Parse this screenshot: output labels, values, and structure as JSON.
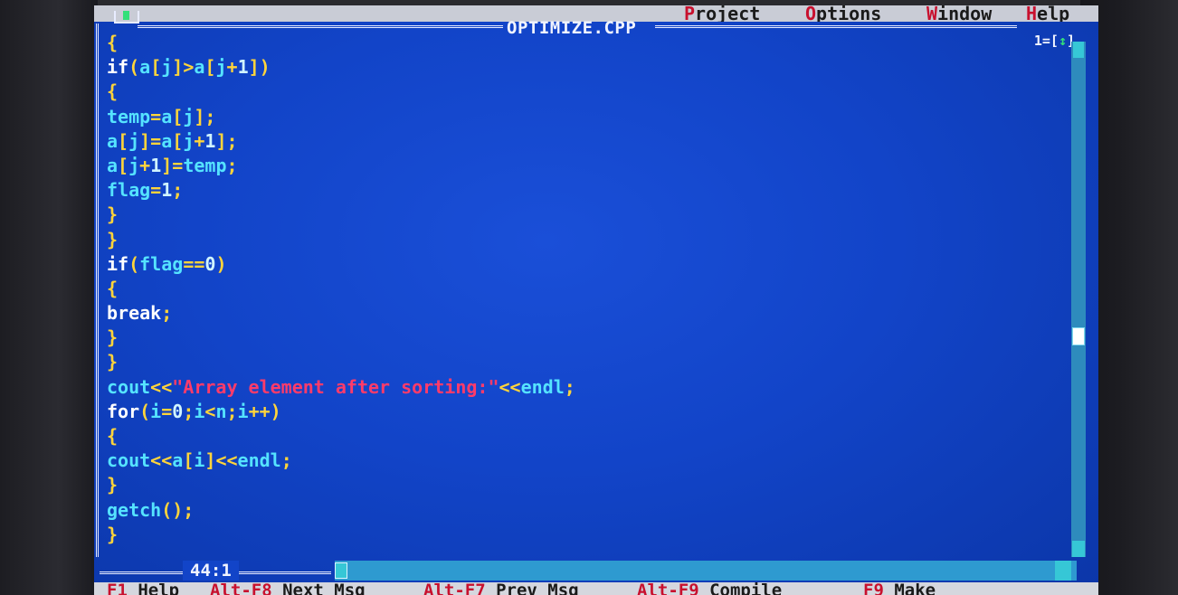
{
  "menubar": {
    "items": [
      {
        "label": "Project",
        "hot": "P"
      },
      {
        "label": "Options",
        "hot": "O"
      },
      {
        "label": "Window",
        "hot": "W"
      },
      {
        "label": "Help",
        "hot": "H"
      }
    ]
  },
  "window": {
    "title": "OPTIMIZE.CPP",
    "number": "1=[",
    "zoom_glyph": "↕",
    "zoom_close": "]"
  },
  "code_lines": [
    [
      {
        "t": "{",
        "c": "pun"
      }
    ],
    [
      {
        "t": "if",
        "c": "kw"
      },
      {
        "t": "(",
        "c": "pun"
      },
      {
        "t": "a",
        "c": "ident"
      },
      {
        "t": "[",
        "c": "pun"
      },
      {
        "t": "j",
        "c": "ident"
      },
      {
        "t": "]>",
        "c": "pun"
      },
      {
        "t": "a",
        "c": "ident"
      },
      {
        "t": "[",
        "c": "pun"
      },
      {
        "t": "j",
        "c": "ident"
      },
      {
        "t": "+",
        "c": "pun"
      },
      {
        "t": "1",
        "c": "num"
      },
      {
        "t": "])",
        "c": "pun"
      }
    ],
    [
      {
        "t": "{",
        "c": "pun"
      }
    ],
    [
      {
        "t": "temp",
        "c": "ident"
      },
      {
        "t": "=",
        "c": "pun"
      },
      {
        "t": "a",
        "c": "ident"
      },
      {
        "t": "[",
        "c": "pun"
      },
      {
        "t": "j",
        "c": "ident"
      },
      {
        "t": "];",
        "c": "pun"
      }
    ],
    [
      {
        "t": "a",
        "c": "ident"
      },
      {
        "t": "[",
        "c": "pun"
      },
      {
        "t": "j",
        "c": "ident"
      },
      {
        "t": "]=",
        "c": "pun"
      },
      {
        "t": "a",
        "c": "ident"
      },
      {
        "t": "[",
        "c": "pun"
      },
      {
        "t": "j",
        "c": "ident"
      },
      {
        "t": "+",
        "c": "pun"
      },
      {
        "t": "1",
        "c": "num"
      },
      {
        "t": "];",
        "c": "pun"
      }
    ],
    [
      {
        "t": "a",
        "c": "ident"
      },
      {
        "t": "[",
        "c": "pun"
      },
      {
        "t": "j",
        "c": "ident"
      },
      {
        "t": "+",
        "c": "pun"
      },
      {
        "t": "1",
        "c": "num"
      },
      {
        "t": "]=",
        "c": "pun"
      },
      {
        "t": "temp",
        "c": "ident"
      },
      {
        "t": ";",
        "c": "pun"
      }
    ],
    [
      {
        "t": "flag",
        "c": "ident"
      },
      {
        "t": "=",
        "c": "pun"
      },
      {
        "t": "1",
        "c": "num"
      },
      {
        "t": ";",
        "c": "pun"
      }
    ],
    [
      {
        "t": "}",
        "c": "pun"
      }
    ],
    [
      {
        "t": "}",
        "c": "pun"
      }
    ],
    [
      {
        "t": "if",
        "c": "kw"
      },
      {
        "t": "(",
        "c": "pun"
      },
      {
        "t": "flag",
        "c": "ident"
      },
      {
        "t": "==",
        "c": "pun"
      },
      {
        "t": "0",
        "c": "num"
      },
      {
        "t": ")",
        "c": "pun"
      }
    ],
    [
      {
        "t": "{",
        "c": "pun"
      }
    ],
    [
      {
        "t": "break",
        "c": "kw"
      },
      {
        "t": ";",
        "c": "pun"
      }
    ],
    [
      {
        "t": "}",
        "c": "pun"
      }
    ],
    [
      {
        "t": "}",
        "c": "pun"
      }
    ],
    [
      {
        "t": "cout",
        "c": "ident"
      },
      {
        "t": "<<",
        "c": "pun"
      },
      {
        "t": "\"Array element after sorting:\"",
        "c": "str"
      },
      {
        "t": "<<",
        "c": "pun"
      },
      {
        "t": "endl",
        "c": "ident"
      },
      {
        "t": ";",
        "c": "pun"
      }
    ],
    [
      {
        "t": "for",
        "c": "kw"
      },
      {
        "t": "(",
        "c": "pun"
      },
      {
        "t": "i",
        "c": "ident"
      },
      {
        "t": "=",
        "c": "pun"
      },
      {
        "t": "0",
        "c": "num"
      },
      {
        "t": ";",
        "c": "pun"
      },
      {
        "t": "i",
        "c": "ident"
      },
      {
        "t": "<",
        "c": "pun"
      },
      {
        "t": "n",
        "c": "ident"
      },
      {
        "t": ";",
        "c": "pun"
      },
      {
        "t": "i",
        "c": "ident"
      },
      {
        "t": "++)",
        "c": "pun"
      }
    ],
    [
      {
        "t": "{",
        "c": "pun"
      }
    ],
    [
      {
        "t": "cout",
        "c": "ident"
      },
      {
        "t": "<<",
        "c": "pun"
      },
      {
        "t": "a",
        "c": "ident"
      },
      {
        "t": "[",
        "c": "pun"
      },
      {
        "t": "i",
        "c": "ident"
      },
      {
        "t": "]<<",
        "c": "pun"
      },
      {
        "t": "endl",
        "c": "ident"
      },
      {
        "t": ";",
        "c": "pun"
      }
    ],
    [
      {
        "t": "}",
        "c": "pun"
      }
    ],
    [
      {
        "t": "getch",
        "c": "ident"
      },
      {
        "t": "();",
        "c": "pun"
      }
    ],
    [
      {
        "t": "}",
        "c": "pun"
      }
    ]
  ],
  "editor": {
    "cursor_position": "44:1"
  },
  "statusbar": {
    "items": [
      {
        "key": "F1",
        "label": "Help"
      },
      {
        "key": "Alt-F8",
        "label": "Next Msg"
      },
      {
        "key": "Alt-F7",
        "label": "Prev Msg"
      },
      {
        "key": "Alt-F9",
        "label": "Compile"
      },
      {
        "key": "F9",
        "label": "Make"
      }
    ]
  },
  "colors": {
    "editor_background": "#1244c8",
    "keyword": "#ffffff",
    "identifier": "#55e3ff",
    "punctuation": "#ffd43b",
    "string": "#ff3b6a",
    "menu_hotkey": "#c8102e"
  }
}
